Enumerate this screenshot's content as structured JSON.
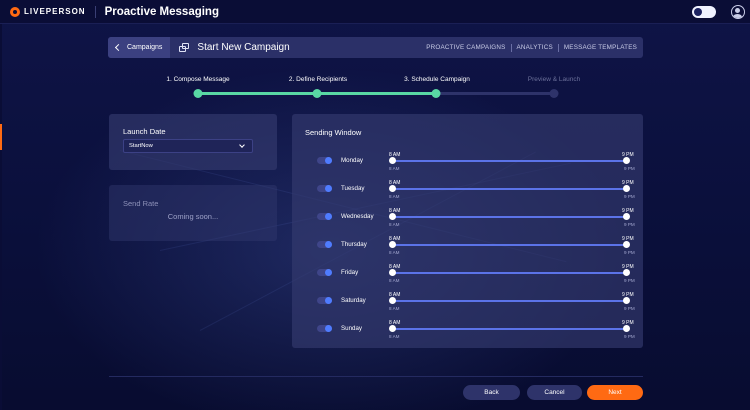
{
  "brand": {
    "logo_text": "LIVEPERSON",
    "app_title": "Proactive Messaging"
  },
  "campaign_bar": {
    "back_label": "Campaigns",
    "title": "Start New Campaign",
    "nav": [
      "PROACTIVE CAMPAIGNS",
      "ANALYTICS",
      "MESSAGE TEMPLATES"
    ]
  },
  "steps": [
    {
      "label": "1. Compose Message",
      "state": "done"
    },
    {
      "label": "2. Define Recipients",
      "state": "done"
    },
    {
      "label": "3. Schedule Campaign",
      "state": "done"
    },
    {
      "label": "Preview & Launch",
      "state": "pending"
    }
  ],
  "launch_date": {
    "title": "Launch Date",
    "selected": "StartNow"
  },
  "send_rate": {
    "title": "Send Rate",
    "message": "Coming soon..."
  },
  "sending_window": {
    "title": "Sending Window",
    "days": [
      {
        "name": "Monday",
        "start": "8 AM",
        "end": "9 PM",
        "min": "8 AM",
        "max": "9 PM"
      },
      {
        "name": "Tuesday",
        "start": "8 AM",
        "end": "9 PM",
        "min": "8 AM",
        "max": "9 PM"
      },
      {
        "name": "Wednesday",
        "start": "8 AM",
        "end": "9 PM",
        "min": "8 AM",
        "max": "9 PM"
      },
      {
        "name": "Thursday",
        "start": "8 AM",
        "end": "9 PM",
        "min": "8 AM",
        "max": "9 PM"
      },
      {
        "name": "Friday",
        "start": "8 AM",
        "end": "9 PM",
        "min": "8 AM",
        "max": "9 PM"
      },
      {
        "name": "Saturday",
        "start": "8 AM",
        "end": "9 PM",
        "min": "8 AM",
        "max": "9 PM"
      },
      {
        "name": "Sunday",
        "start": "8 AM",
        "end": "9 PM",
        "min": "8 AM",
        "max": "9 PM"
      }
    ]
  },
  "footer": {
    "back": "Back",
    "cancel": "Cancel",
    "next": "Next"
  },
  "colors": {
    "accent": "#ff6a13",
    "progress": "#59d8a4",
    "slider": "#5b73e8",
    "background": "#0b0f3a"
  }
}
